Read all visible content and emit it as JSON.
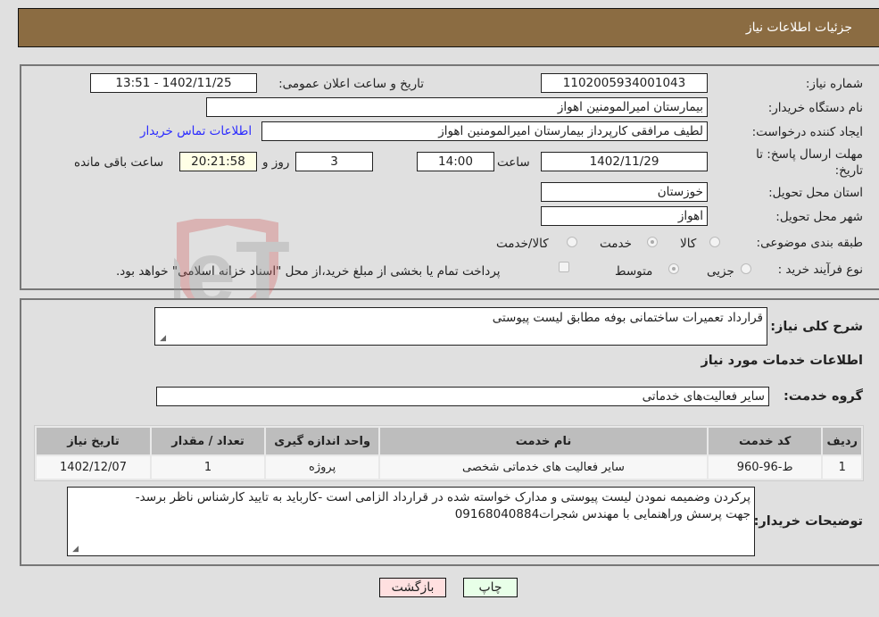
{
  "header": {
    "title": "جزئیات اطلاعات نیاز"
  },
  "details": {
    "need_number": {
      "label": "شماره نیاز:",
      "value": "1102005934001043"
    },
    "announce_datetime": {
      "label": "تاریخ و ساعت اعلان عمومی:",
      "value": "1402/11/25 - 13:51"
    },
    "buyer_org": {
      "label": "نام دستگاه خریدار:",
      "value": "بیمارستان امیرالمومنین اهواز"
    },
    "requester": {
      "label": "ایجاد کننده درخواست:",
      "value": "لطیف مرافقی کارپرداز بیمارستان امیرالمومنین اهواز"
    },
    "contact_link": "اطلاعات تماس خریدار",
    "deadline": {
      "label": "مهلت ارسال پاسخ: تا تاریخ:",
      "date": "1402/11/29",
      "time_label": "ساعت",
      "time": "14:00",
      "days": "3",
      "days_label": "روز و",
      "remaining": "20:21:58",
      "remaining_label": "ساعت باقی مانده"
    },
    "province": {
      "label": "استان محل تحویل:",
      "value": "خوزستان"
    },
    "city": {
      "label": "شهر محل تحویل:",
      "value": "اهواز"
    },
    "category": {
      "label": "طبقه بندی موضوعی:",
      "options": [
        "کالا",
        "خدمت",
        "کالا/خدمت"
      ],
      "selected": "خدمت"
    },
    "purchase_type": {
      "label": "نوع فرآیند خرید :",
      "options": [
        "جزیی",
        "متوسط"
      ],
      "selected": "متوسط",
      "treasury_note": "پرداخت تمام یا بخشی از مبلغ خرید،از محل \"اسناد خزانه اسلامی\" خواهد بود.",
      "treasury_checked": false
    }
  },
  "description": {
    "label": "شرح کلی نیاز:",
    "value": "قرارداد تعمیرات ساختمانی بوفه مطابق لیست پیوستی"
  },
  "services": {
    "section_title": "اطلاعات خدمات مورد نیاز",
    "group_label": "گروه خدمت:",
    "group_value": "سایر فعالیت‌های خدماتی",
    "table": {
      "headers": [
        "ردیف",
        "کد خدمت",
        "نام خدمت",
        "واحد اندازه گیری",
        "تعداد / مقدار",
        "تاریخ نیاز"
      ],
      "rows": [
        [
          "1",
          "ط-96-960",
          "سایر فعالیت های خدماتی شخصی",
          "پروژه",
          "1",
          "1402/12/07"
        ]
      ]
    }
  },
  "buyer_notes": {
    "label": "توضیحات خریدار:",
    "line1": "پرکردن وضمیمه نمودن لیست پیوستی و مدارک خواسته شده در قرارداد الزامی است -کارباید به تایید کارشناس ناظر برسد-",
    "line2": "جهت پرسش وراهنمایی با مهندس شجرات09168040884"
  },
  "buttons": {
    "print": "چاپ",
    "back": "بازگشت"
  },
  "watermark": {
    "text": "AriaTender.neT"
  },
  "colors": {
    "header_bg": "#8b6c42",
    "back_btn": "#ffe0e0",
    "print_btn": "#e8ffe8",
    "link": "#2a2aff"
  }
}
